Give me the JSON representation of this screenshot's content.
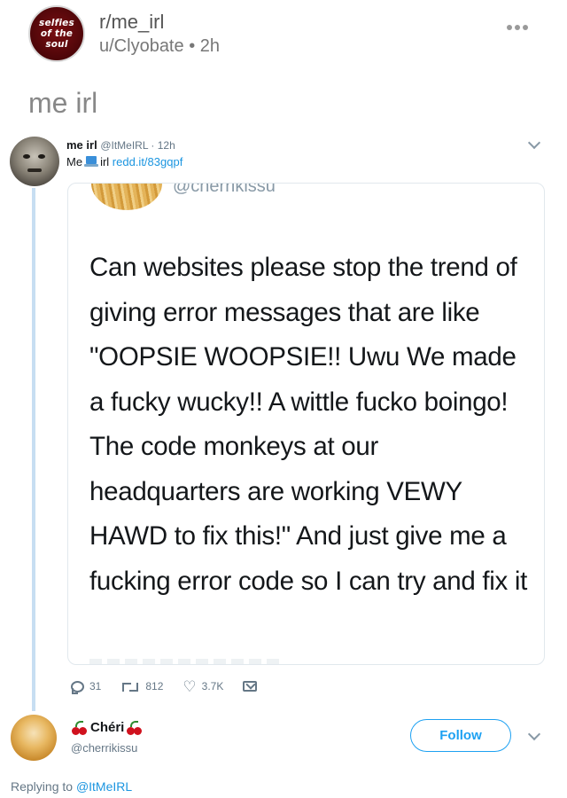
{
  "subreddit": {
    "icon_text": [
      "selfies",
      "of the",
      "soul"
    ],
    "name": "r/me_irl",
    "user": "u/Clyobate",
    "separator": "•",
    "age": "2h"
  },
  "post": {
    "title": "me irl"
  },
  "tweet": {
    "display_name": "me irl",
    "handle_time": "@ItMeIRL · 12h",
    "text_before": "Me",
    "text_after": "irl",
    "link": "redd.it/83gqpf",
    "laptop_icon": "laptop-emoji-icon",
    "quoted": {
      "handle": "@cherrikissu",
      "text": "Can websites please stop the trend of giving error messages that are like \"OOPSIE WOOPSIE!! Uwu We made a fucky wucky!! A wittle fucko boingo! The code monkeys at our headquarters are working VEWY HAWD to fix this!\" And just give me a fucking error code so I can try and fix it"
    },
    "actions": {
      "replies": "31",
      "retweets": "812",
      "likes": "3.7K"
    }
  },
  "reply": {
    "name": "Chéri",
    "handle": "@cherrikissu",
    "follow_label": "Follow",
    "replying_prefix": "Replying to",
    "replying_to": "@ItMeIRL"
  },
  "colors": {
    "twitter_blue": "#1da1f2",
    "link_blue": "#1b95e0",
    "muted_gray": "#657786",
    "thread_line": "#c7def2"
  }
}
